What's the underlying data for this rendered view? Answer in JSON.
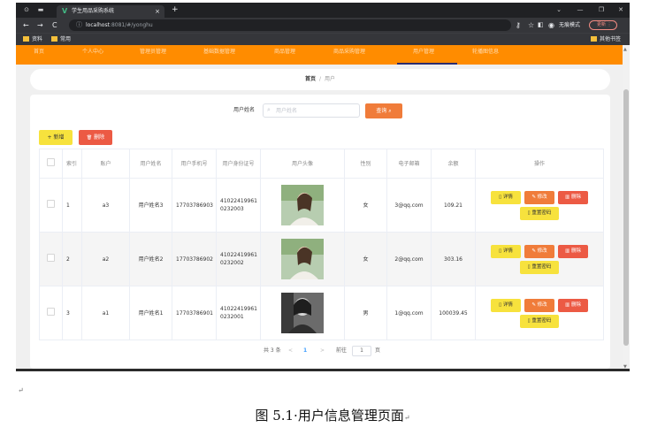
{
  "browser": {
    "tab_title": "学生用品采购系统",
    "tab_close": "×",
    "new_tab": "+",
    "window_controls": [
      "⌄",
      "—",
      "❐",
      "✕"
    ],
    "nav_icons": [
      "←",
      "→",
      "C"
    ],
    "url_host": "localhost",
    "url_path": ":8081/#/yonghu",
    "incognito_label": "无痕模式",
    "update_label": "更新",
    "menu_icon": "⋮",
    "bookmarks": [
      "资料",
      "常用"
    ],
    "other_bookmarks": "其他书签",
    "icon_names": [
      "chrome-icon",
      "tab-icon",
      "vue-icon",
      "key-icon",
      "star-icon",
      "sidebar-icon",
      "incognito-icon"
    ]
  },
  "nav": {
    "items": [
      "首页",
      "个人中心",
      "管理员管理",
      "基础数据管理",
      "商品管理",
      "商品采购管理",
      "用户管理",
      "轮播图信息"
    ],
    "active_index": 6,
    "bg_color": "#ff8c00"
  },
  "breadcrumb": {
    "home": "首页",
    "separator": "/",
    "current": "用户"
  },
  "search": {
    "label": "用户姓名",
    "placeholder": "用户姓名",
    "query_button": "查询",
    "query_color": "#f07c3a"
  },
  "toolbar": {
    "add_label": "新增",
    "add_icon": "+",
    "delete_label": "删除",
    "delete_icon": "🗑",
    "add_color": "#f7e23d",
    "delete_color": "#ec5a44"
  },
  "table": {
    "headers": [
      "索引",
      "账户",
      "用户姓名",
      "用户手机号",
      "用户身份证号",
      "用户头像",
      "性别",
      "电子邮箱",
      "余额",
      "操作"
    ],
    "rows": [
      {
        "index": "1",
        "account": "a3",
        "name": "用户姓名3",
        "phone": "17703786903",
        "id_card": "410224199610232003",
        "avatar": "female-portrait",
        "gender": "女",
        "email": "3@qq.com",
        "balance": "109.21"
      },
      {
        "index": "2",
        "account": "a2",
        "name": "用户姓名2",
        "phone": "17703786902",
        "id_card": "410224199610232002",
        "avatar": "female-portrait",
        "gender": "女",
        "email": "2@qq.com",
        "balance": "303.16"
      },
      {
        "index": "3",
        "account": "a1",
        "name": "用户姓名1",
        "phone": "17703786901",
        "id_card": "410224199610232001",
        "avatar": "grayscale-portrait",
        "gender": "男",
        "email": "1@qq.com",
        "balance": "100039.45"
      }
    ],
    "actions": {
      "detail": "详情",
      "edit": "修改",
      "delete": "删除",
      "reset": "重置密码"
    }
  },
  "pagination": {
    "total": "共 3 条",
    "prev": "<",
    "current": "1",
    "next": ">",
    "goto": "前往",
    "page_input": "1",
    "unit": "页"
  },
  "document": {
    "paragraph_mark": "↵",
    "caption": "图 5.1·用户信息管理页面",
    "caption_mark": "↵"
  }
}
